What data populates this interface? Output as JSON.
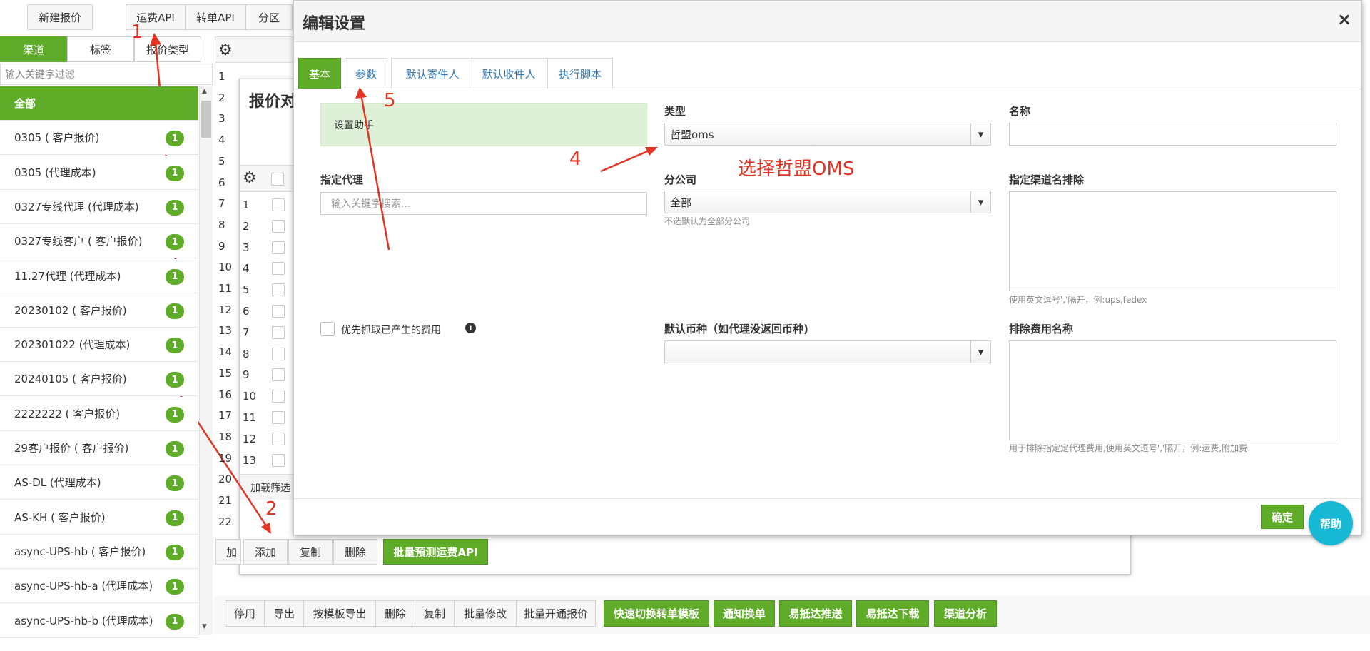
{
  "toolbar_top": {
    "new_quote": "新建报价",
    "freight_api": "运费API",
    "transfer_api": "转单API",
    "zone": "分区"
  },
  "left_tabs": {
    "channel": "渠道",
    "tag": "标签",
    "quote_type": "报价类型"
  },
  "filter_placeholder": "输入关键字过滤",
  "channel_list": [
    {
      "label": "全部",
      "count": ""
    },
    {
      "label": "0305 ( 客户报价)",
      "count": "1"
    },
    {
      "label": "0305 (代理成本)",
      "count": "1"
    },
    {
      "label": "0327专线代理 (代理成本)",
      "count": "1"
    },
    {
      "label": "0327专线客户 ( 客户报价)",
      "count": "1"
    },
    {
      "label": "11.27代理 (代理成本)",
      "count": "1"
    },
    {
      "label": "20230102 ( 客户报价)",
      "count": "1"
    },
    {
      "label": "202301022 (代理成本)",
      "count": "1"
    },
    {
      "label": "20240105 ( 客户报价)",
      "count": "1"
    },
    {
      "label": "2222222 ( 客户报价)",
      "count": "1"
    },
    {
      "label": "29客户报价 ( 客户报价)",
      "count": "1"
    },
    {
      "label": "AS-DL (代理成本)",
      "count": "1"
    },
    {
      "label": "AS-KH ( 客户报价)",
      "count": "1"
    },
    {
      "label": "async-UPS-hb ( 客户报价)",
      "count": "1"
    },
    {
      "label": "async-UPS-hb-a (代理成本)",
      "count": "1"
    },
    {
      "label": "async-UPS-hb-b (代理成本)",
      "count": "1"
    }
  ],
  "grid_rows": [
    "1",
    "2",
    "3",
    "4",
    "5",
    "6",
    "7",
    "8",
    "9",
    "10",
    "11",
    "12",
    "13",
    "14",
    "15",
    "16",
    "17",
    "18",
    "19",
    "20",
    "21",
    "22"
  ],
  "inner_rows": [
    "1",
    "2",
    "3",
    "4",
    "5",
    "6",
    "7",
    "8",
    "9",
    "10",
    "11",
    "12",
    "13"
  ],
  "inner_panel": {
    "title": "报价对",
    "load_filter": "加载筛选",
    "load_short": "加",
    "add": "添加",
    "copy": "复制",
    "delete": "删除",
    "batch_api": "批量預测运费API"
  },
  "bottom_bar": {
    "disable": "停用",
    "export": "导出",
    "export_template": "按模板导出",
    "delete": "删除",
    "copy": "复制",
    "batch_edit": "批量修改",
    "batch_open": "批量开通报价",
    "switch_template": "快速切换转单模板",
    "notify": "通知换单",
    "ydd_push": "易抵达推送",
    "ydd_download": "易抵达下载",
    "channel_analysis": "渠道分析"
  },
  "modal": {
    "title": "编辑设置",
    "close": "×",
    "tabs": [
      "基本",
      "参数",
      "默认寄件人",
      "默认收件人",
      "执行脚本"
    ],
    "helper": "设置助手",
    "type_label": "类型",
    "type_value": "哲盟oms",
    "name_label": "名称",
    "name_value": "",
    "agent_label": "指定代理",
    "agent_placeholder": "输入关键字搜索...",
    "branch_label": "分公司",
    "branch_value": "全部",
    "branch_hint": "不选默认为全部分公司",
    "exclude_channel_label": "指定渠道名排除",
    "exclude_channel_hint": "使用英文逗号','隔开，例:ups,fedex",
    "prefer_fetch_label": "优先抓取已产生的费用",
    "currency_label": "默认币种（如代理没返回币种)",
    "currency_value": "",
    "exclude_fee_label": "排除费用名称",
    "exclude_fee_hint": "用于排除指定定代理费用,使用英文逗号','隔开，例:运费,附加费",
    "confirm": "确定",
    "help": "帮助"
  },
  "annotations": {
    "n1": "1",
    "n2": "2",
    "n4": "4",
    "n5": "5",
    "choose_oms": "选择哲盟OMS",
    "color": "#e53323"
  },
  "colors": {
    "accent_green": "#5fac28",
    "link_blue": "#337ab7",
    "help_cyan": "#17b8d4"
  }
}
